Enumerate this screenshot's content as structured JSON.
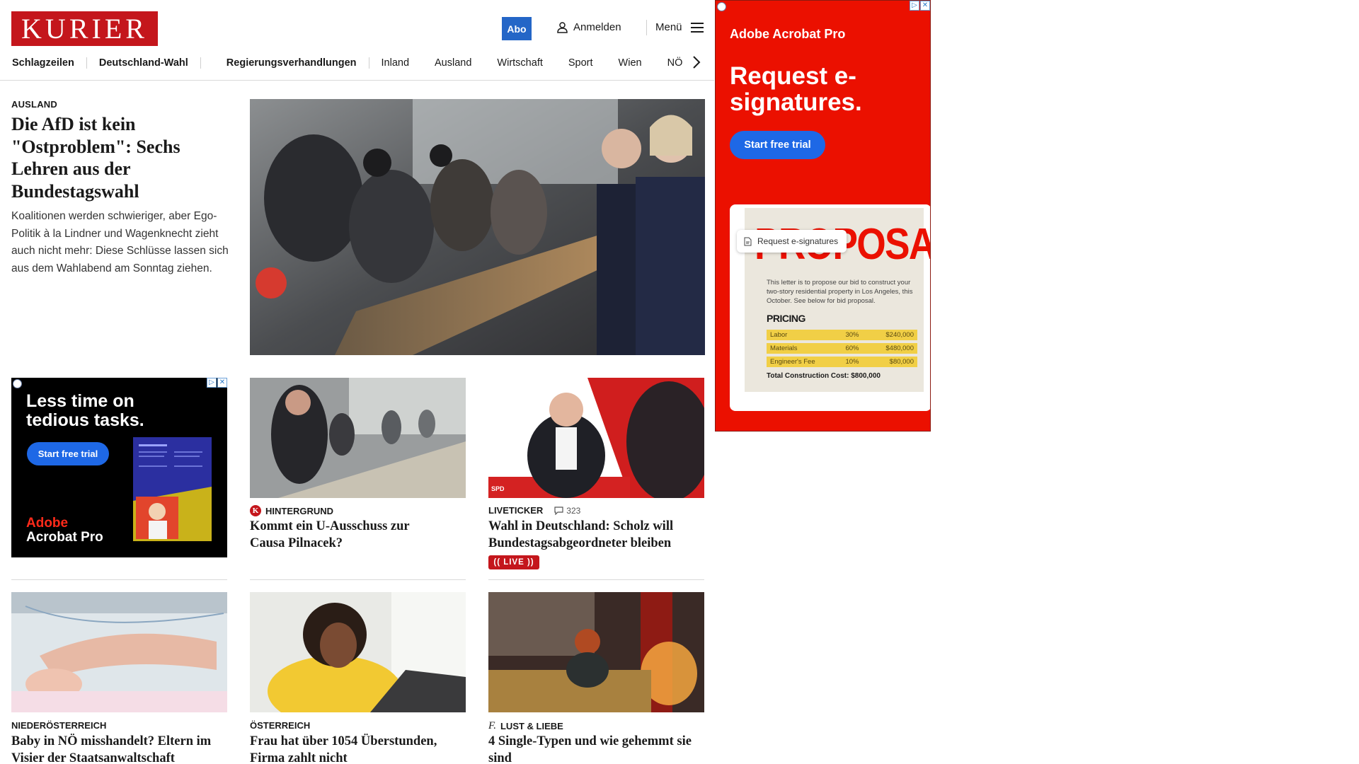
{
  "header": {
    "logo": "KURIER",
    "abo_label": "Abo",
    "login_label": "Anmelden",
    "menu_label": "Menü"
  },
  "nav": {
    "items": [
      "Schlagzeilen",
      "Deutschland-Wahl",
      "Regierungsverhandlungen",
      "Inland",
      "Ausland",
      "Wirtschaft",
      "Sport",
      "Wien",
      "NÖ"
    ]
  },
  "lead": {
    "kicker": "AUSLAND",
    "title": "Die AfD ist kein \"Ostproblem\": Sechs Lehren aus der Bundestagswahl",
    "teaser": "Koalitionen werden schwieriger, aber Ego-Politik à la Lindner und Wagenknecht zieht auch nicht mehr: Diese Schlüsse lassen sich aus dem Wahlabend am Sonntag ziehen."
  },
  "cards": [
    {
      "kicker": "HINTERGRUND",
      "title": "Kommt ein U-Ausschuss zur Causa Pilnacek?",
      "badge": "K"
    },
    {
      "kicker": "LIVETICKER",
      "title": "Wahl in Deutschland: Scholz will Bundestagsabgeordneter bleiben",
      "comments": "323",
      "live": "(( LIVE ))"
    },
    {
      "kicker": "NIEDERÖSTERREICH",
      "title": "Baby in NÖ misshandelt? Eltern im Visier der Staatsanwaltschaft"
    },
    {
      "kicker": "ÖSTERREICH",
      "title": "Frau hat über 1054 Überstunden, Firma zahlt nicht"
    },
    {
      "kicker": "LUST & LIEBE",
      "title": "4 Single-Typen und wie gehemmt sie sind",
      "badge": "f."
    }
  ],
  "ad_small": {
    "headline": "Less time on tedious tasks.",
    "cta": "Start free trial",
    "brand_top": "Adobe",
    "brand_bottom": "Acrobat Pro"
  },
  "ad_big": {
    "brand": "Adobe Acrobat Pro",
    "headline": "Request e-signatures.",
    "cta": "Start free trial",
    "pill": "Request e-signatures",
    "proposal": "PROPOSAL",
    "letter": "This letter is to propose our bid to construct your two-story residential property in Los Angeles, this October. See below for bid proposal.",
    "pricing_title": "PRICING",
    "pricing_rows": [
      [
        "Labor",
        "30%",
        "$240,000"
      ],
      [
        "Materials",
        "60%",
        "$480,000"
      ],
      [
        "Engineer's Fee",
        "10%",
        "$80,000"
      ]
    ],
    "total": "Total Construction Cost: $800,000"
  },
  "colors": {
    "brand_red": "#c4161c",
    "abo_blue": "#2466c7",
    "adobe_red": "#eb1000",
    "cta_blue": "#1e68e6"
  }
}
